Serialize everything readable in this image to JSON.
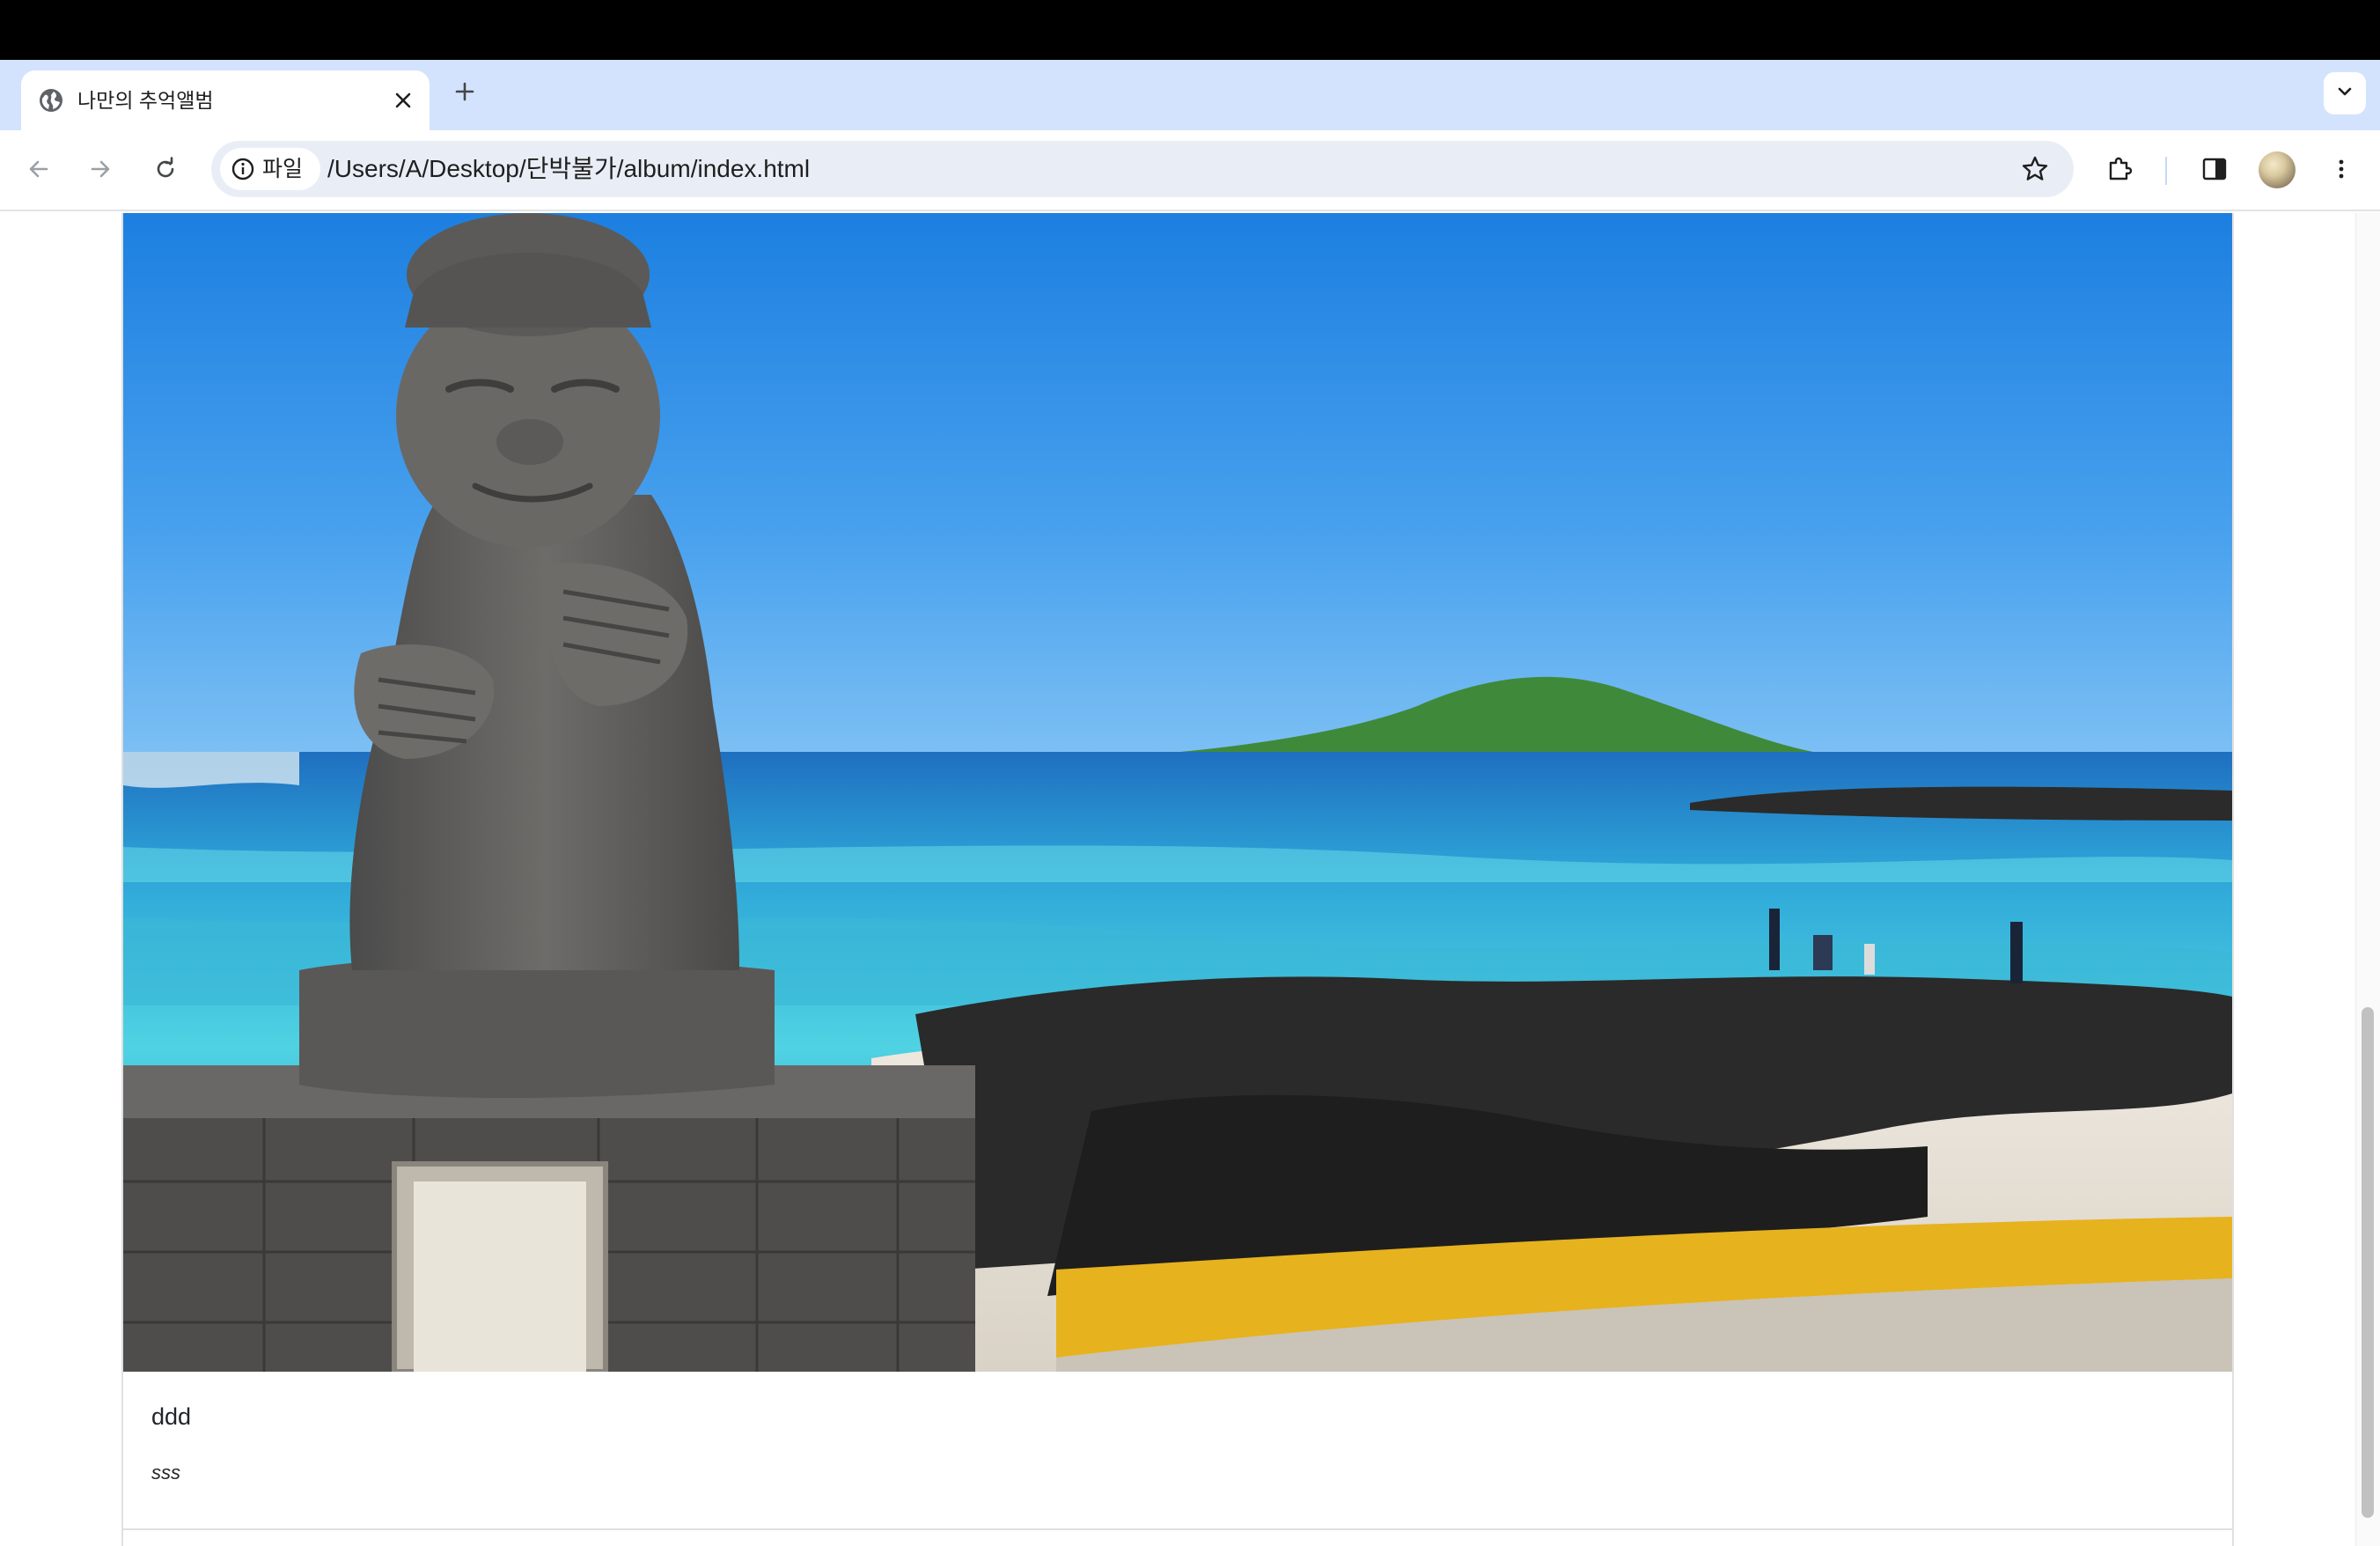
{
  "browser": {
    "tab": {
      "title": "나만의 추억앨범",
      "favicon_icon": "globe-icon",
      "close_icon": "close-icon"
    },
    "new_tab_icon": "plus-icon",
    "tab_search_icon": "chevron-down-icon",
    "nav": {
      "back_icon": "arrow-left-icon",
      "forward_icon": "arrow-right-icon",
      "reload_icon": "reload-icon"
    },
    "omnibox": {
      "chip_label": "파일",
      "chip_icon": "info-icon",
      "url": "/Users/A/Desktop/단박불가/album/index.html"
    },
    "actions": [
      "star-icon",
      "extensions-icon",
      "side-panel-icon",
      "avatar",
      "more-vert-icon"
    ]
  },
  "album": {
    "card": {
      "image_icon": "album-photo",
      "title": "ddd",
      "text": "sss"
    }
  },
  "colors": {
    "tab_strip": "#d3e3fd",
    "omnibox": "#e9eef6",
    "sky": "#2d8fe6",
    "sea": "#3fc6de"
  }
}
